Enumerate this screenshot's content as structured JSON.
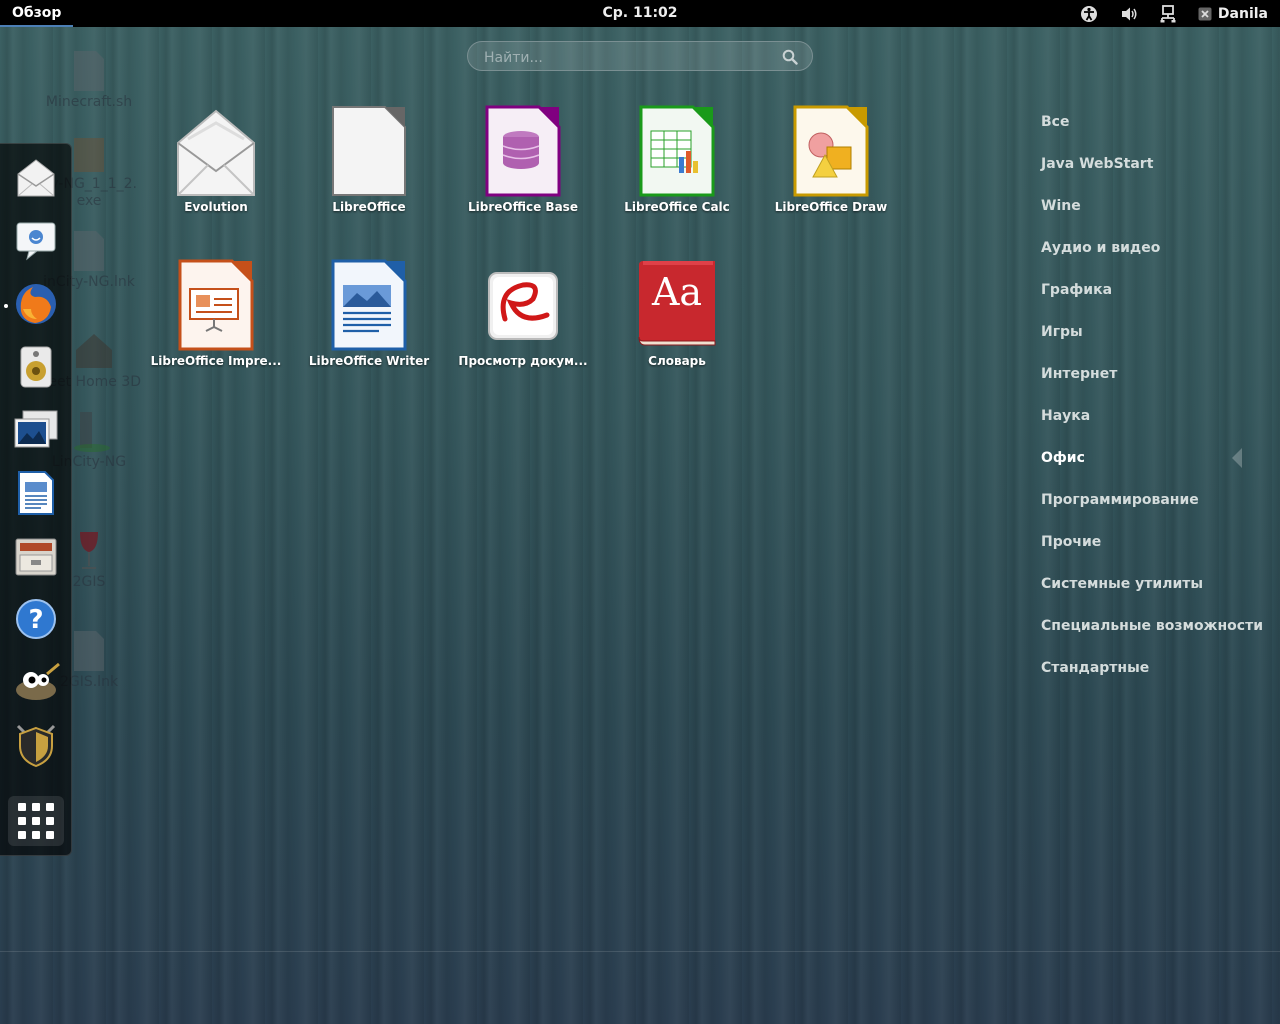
{
  "topbar": {
    "activities": "Обзор",
    "clock": "Ср. 11:02",
    "user": "Danila",
    "tray_icons": [
      "accessibility-icon",
      "volume-icon",
      "network-icon",
      "user-status-icon"
    ]
  },
  "search": {
    "placeholder": "Найти..."
  },
  "desktop": {
    "icons": [
      {
        "label": "Minecraft.sh"
      },
      {
        "label": "ity-NG_1_1_2.",
        "label2": "exe"
      },
      {
        "label": "inCity-NG.lnk"
      },
      {
        "label": "weet Home 3D"
      },
      {
        "label": "LinCity-NG"
      },
      {
        "label": "2GIS"
      },
      {
        "label": "2GIS.lnk"
      }
    ]
  },
  "dash": {
    "items": [
      {
        "name": "evolution-mail",
        "icon": "envelope-icon"
      },
      {
        "name": "empathy-chat",
        "icon": "chat-bubble-icon"
      },
      {
        "name": "firefox",
        "icon": "firefox-icon"
      },
      {
        "name": "rhythmbox",
        "icon": "speaker-icon"
      },
      {
        "name": "shotwell",
        "icon": "photos-icon"
      },
      {
        "name": "libreoffice-writer",
        "icon": "writer-document-icon"
      },
      {
        "name": "file-manager",
        "icon": "file-cabinet-icon"
      },
      {
        "name": "help",
        "icon": "help-icon"
      },
      {
        "name": "gimp",
        "icon": "gimp-icon"
      },
      {
        "name": "security",
        "icon": "shield-icon"
      }
    ],
    "show_apps": "show-applications-icon"
  },
  "apps": [
    {
      "label": "Evolution",
      "icon": "evolution-icon"
    },
    {
      "label": "LibreOffice",
      "icon": "libreoffice-icon"
    },
    {
      "label": "LibreOffice Base",
      "icon": "libreoffice-base-icon"
    },
    {
      "label": "LibreOffice Calc",
      "icon": "libreoffice-calc-icon"
    },
    {
      "label": "LibreOffice Draw",
      "icon": "libreoffice-draw-icon"
    },
    {
      "label": "LibreOffice Impre...",
      "icon": "libreoffice-impress-icon"
    },
    {
      "label": "LibreOffice Writer",
      "icon": "libreoffice-writer-icon"
    },
    {
      "label": "Просмотр докум...",
      "icon": "document-viewer-icon"
    },
    {
      "label": "Словарь",
      "icon": "dictionary-icon"
    }
  ],
  "categories": [
    "Все",
    "Java WebStart",
    "Wine",
    "Аудио и видео",
    "Графика",
    "Игры",
    "Интернет",
    "Наука",
    "Офис",
    "Программирование",
    "Прочие",
    "Системные утилиты",
    "Специальные возможности",
    "Стандартные"
  ],
  "active_category": "Офис",
  "colors": {
    "base": "#800080",
    "calc": "#1a9a1a",
    "draw": "#c89a00",
    "impress": "#c5501a",
    "writer": "#1f5fa8",
    "dictionary": "#c8282e"
  },
  "dictionary_glyph": "Aa"
}
